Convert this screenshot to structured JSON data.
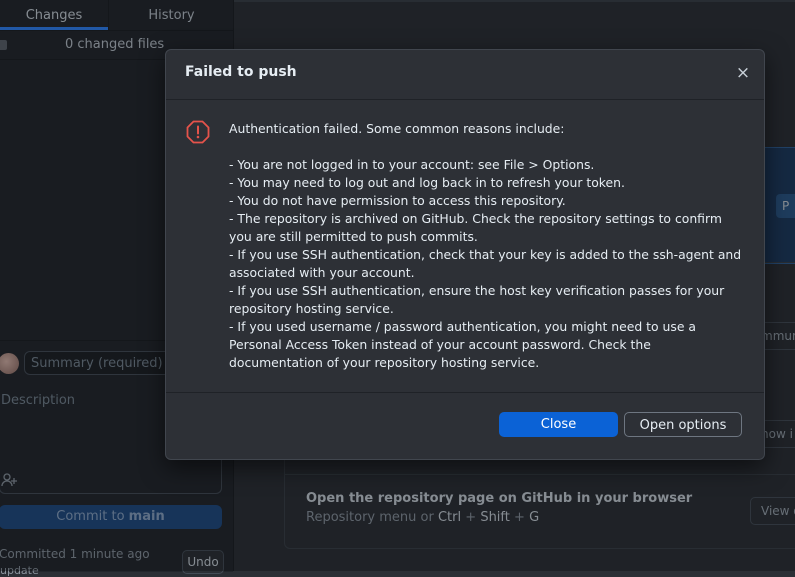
{
  "sidebar": {
    "tabs": [
      {
        "label": "Changes"
      },
      {
        "label": "History"
      }
    ],
    "changed_files": "0 changed files",
    "summary_placeholder": "Summary (required)",
    "description_placeholder": "Description",
    "commit_prefix": "Commit to ",
    "commit_branch": "main",
    "last_commit": "Committed 1 minute ago",
    "last_commit_msg": "update",
    "undo_label": "Undo"
  },
  "main": {
    "partial_button": "P",
    "ghost1": "mmun",
    "ghost2": "how i",
    "open_repo_title": "Open the repository page on GitHub in your browser",
    "open_repo_sub_prefix": "Repository menu or",
    "shortcut": {
      "k1": "Ctrl",
      "sep1": "+",
      "k2": "Shift",
      "sep2": "+",
      "k3": "G"
    },
    "view_button": "View o"
  },
  "dialog": {
    "title": "Failed to push",
    "close_glyph": "×",
    "intro": "Authentication failed. Some common reasons include:",
    "reasons": [
      "- You are not logged in to your account: see File > Options.",
      "- You may need to log out and log back in to refresh your token.",
      "- You do not have permission to access this repository.",
      "- The repository is archived on GitHub. Check the repository settings to confirm you are still permitted to push commits.",
      "- If you use SSH authentication, check that your key is added to the ssh-agent and associated with your account.",
      "- If you use SSH authentication, ensure the host key verification passes for your repository hosting service.",
      "- If you used username / password authentication, you might need to use a Personal Access Token instead of your account password. Check the documentation of your repository hosting service."
    ],
    "close_button": "Close",
    "options_button": "Open options",
    "icon": "alert-octagon-icon",
    "colors": {
      "primary": "#0b62d6",
      "alert": "#e5534b"
    }
  }
}
